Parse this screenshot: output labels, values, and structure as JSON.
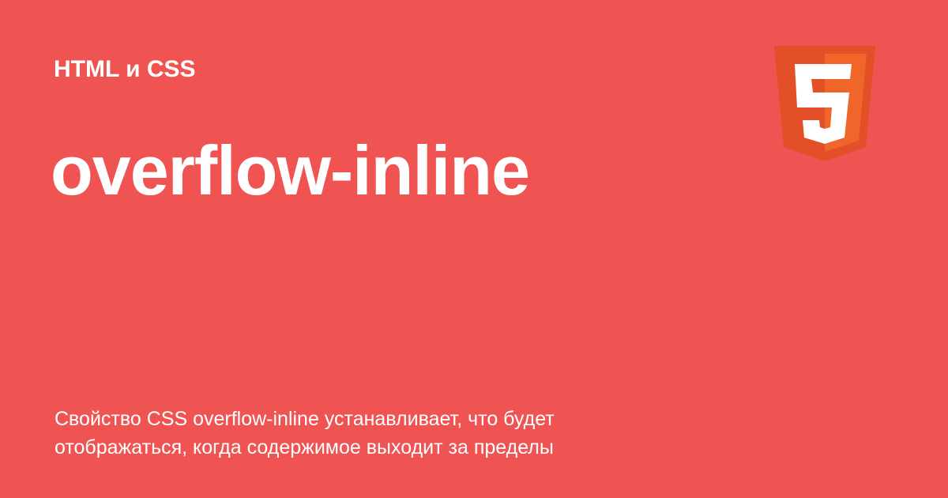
{
  "header": {
    "category": "HTML и CSS"
  },
  "main": {
    "title": "overflow-inline",
    "description": "Свойство CSS overflow-inline устанавливает, что будет отображаться, когда содержимое выходит за пределы"
  },
  "logo": {
    "icon": "html5-logo-icon",
    "digit": "5"
  },
  "colors": {
    "background": "#ef5453",
    "text": "#ffffff",
    "logo_dark": "#e34f26",
    "logo_light": "#f06529"
  }
}
